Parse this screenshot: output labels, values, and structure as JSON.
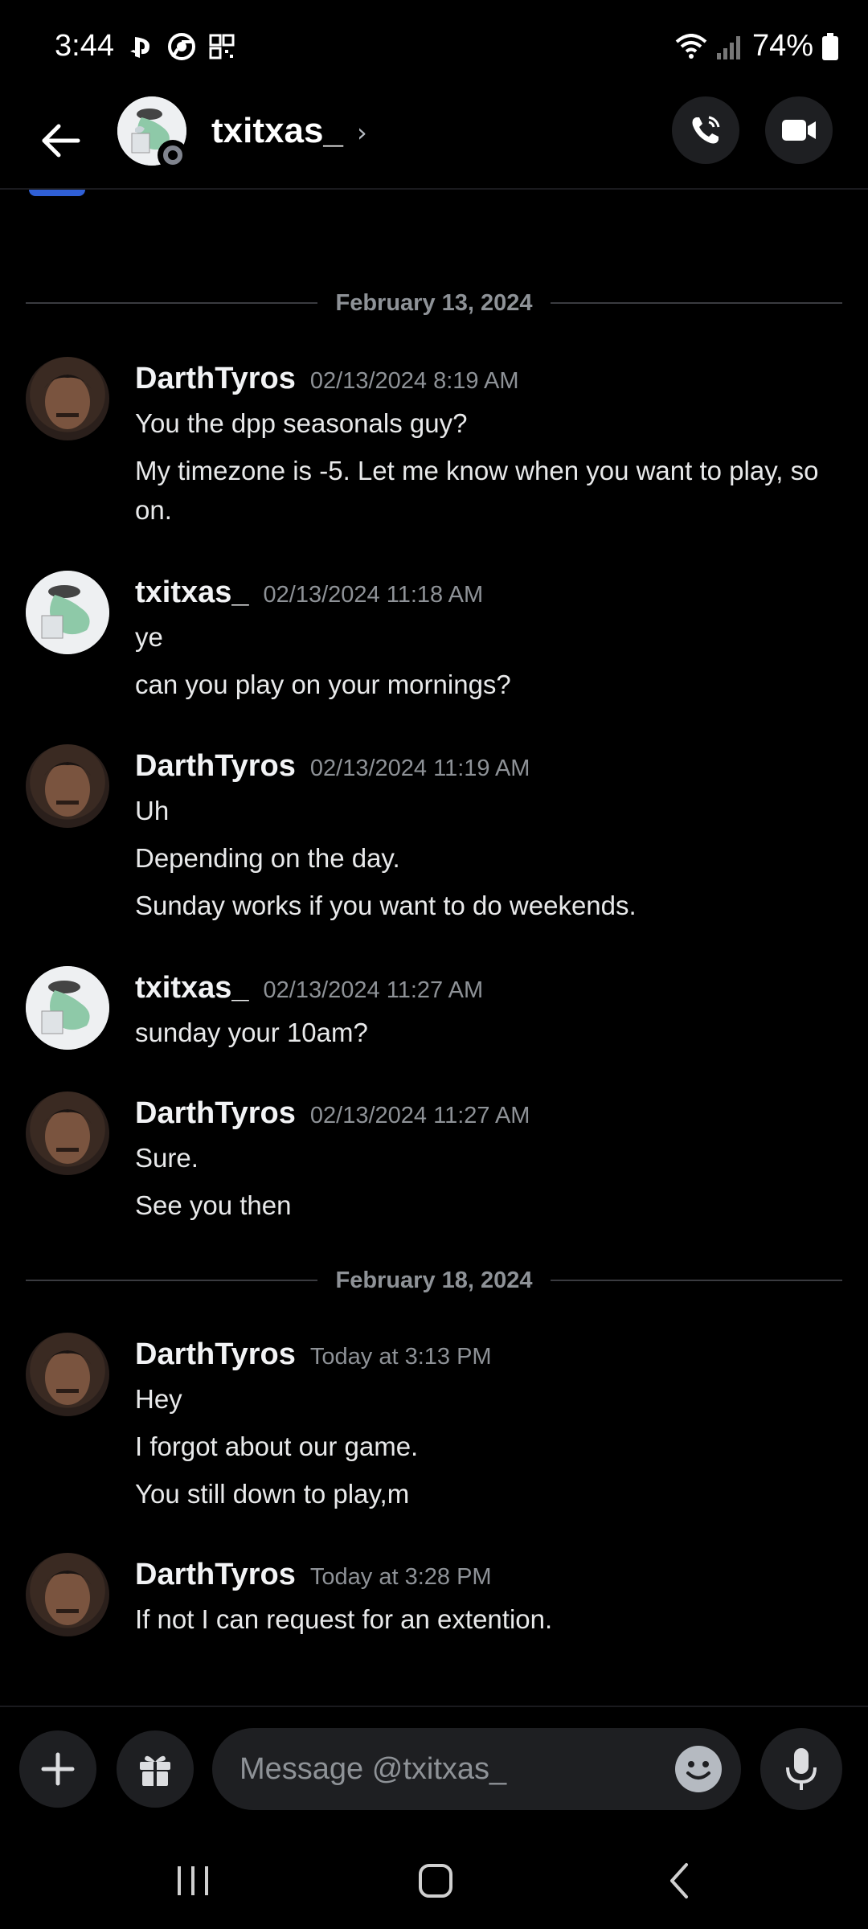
{
  "status_bar": {
    "time": "3:44",
    "battery": "74%",
    "icons_left": [
      "playstation-icon",
      "chrome-icon",
      "qr-icon"
    ],
    "icons_right": [
      "wifi-icon",
      "signal-icon",
      "battery-icon"
    ]
  },
  "header": {
    "name": "txitxas_",
    "chevron": "›",
    "actions": [
      "voice-call-icon",
      "video-call-icon"
    ]
  },
  "conversation": {
    "dividers": [
      {
        "label": "February 13, 2024"
      },
      {
        "label": "February 18, 2024"
      }
    ],
    "messages": [
      {
        "author": "DarthTyros",
        "time": "02/13/2024 8:19 AM",
        "lines": [
          "You the dpp seasonals guy?",
          "My timezone is -5. Let me know when you want to play, so on."
        ]
      },
      {
        "author": "txitxas_",
        "time": "02/13/2024 11:18 AM",
        "lines": [
          "ye",
          "can you play on your mornings?"
        ]
      },
      {
        "author": "DarthTyros",
        "time": "02/13/2024 11:19 AM",
        "lines": [
          "Uh",
          "Depending on the day.",
          "Sunday works if you want to do weekends."
        ]
      },
      {
        "author": "txitxas_",
        "time": "02/13/2024 11:27 AM",
        "lines": [
          "sunday your 10am?"
        ]
      },
      {
        "author": "DarthTyros",
        "time": "02/13/2024 11:27 AM",
        "lines": [
          "Sure.",
          "See you then"
        ]
      },
      {
        "author": "DarthTyros",
        "time": "Today at 3:13 PM",
        "lines": [
          "Hey",
          "I forgot about our game.",
          "You still down to play,m"
        ]
      },
      {
        "author": "DarthTyros",
        "time": "Today at 3:28 PM",
        "lines": [
          "If not I can request for an extention."
        ]
      }
    ]
  },
  "composer": {
    "placeholder": "Message @txitxas_"
  },
  "colors": {
    "background": "#000000",
    "surface": "#1e1f22",
    "muted_text": "#8e9297",
    "accent": "#2f5fd6"
  }
}
